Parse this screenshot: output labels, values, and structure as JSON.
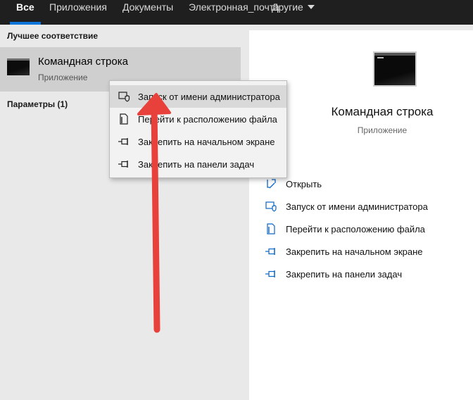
{
  "tabs": [
    {
      "label": "Все",
      "active": true
    },
    {
      "label": "Приложения"
    },
    {
      "label": "Документы"
    },
    {
      "label": "Электронная_почта"
    },
    {
      "label": "Другие"
    }
  ],
  "left": {
    "best_match_title": "Лучшее соответствие",
    "best_item": {
      "name": "Командная строка",
      "type": "Приложение",
      "icon": "cmd-icon"
    },
    "params_title": "Параметры (1)"
  },
  "context_menu": [
    {
      "label": "Запуск от имени администратора",
      "icon": "shield-icon",
      "highlighted": true
    },
    {
      "label": "Перейти к расположению файла",
      "icon": "file-location-icon"
    },
    {
      "label": "Закрепить на начальном экране",
      "icon": "pin-icon"
    },
    {
      "label": "Закрепить на панели задач",
      "icon": "pin-icon"
    }
  ],
  "right": {
    "title": "Командная строка",
    "subtitle": "Приложение",
    "actions": [
      {
        "label": "Открыть",
        "icon": "open-icon"
      },
      {
        "label": "Запуск от имени администратора",
        "icon": "shield-icon"
      },
      {
        "label": "Перейти к расположению файла",
        "icon": "file-location-icon"
      },
      {
        "label": "Закрепить на начальном экране",
        "icon": "pin-icon"
      },
      {
        "label": "Закрепить на панели задач",
        "icon": "pin-icon"
      }
    ]
  },
  "colors": {
    "accent": "#0a74d8",
    "topbar": "#1f1f1f",
    "annotation_arrow": "#e8413b"
  }
}
